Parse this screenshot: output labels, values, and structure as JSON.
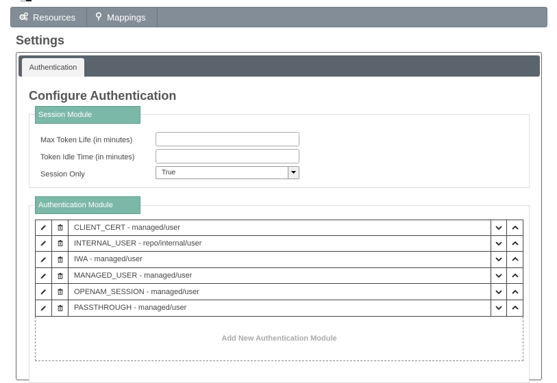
{
  "nav": {
    "items": [
      {
        "label": "Resources",
        "icon": "cogs-icon"
      },
      {
        "label": "Mappings",
        "icon": "map-marker-icon"
      }
    ]
  },
  "page_title": "Settings",
  "tabs": [
    {
      "label": "Authentication",
      "active": true
    }
  ],
  "section_title": "Configure Authentication",
  "session_module": {
    "legend": "Session Module",
    "fields": {
      "max_token_life": {
        "label": "Max Token Life (in minutes)",
        "value": ""
      },
      "token_idle_time": {
        "label": "Token Idle Time (in minutes)",
        "value": ""
      },
      "session_only": {
        "label": "Session Only",
        "value": "True"
      }
    }
  },
  "auth_module": {
    "legend": "Authentication Module",
    "modules": [
      {
        "name": "CLIENT_CERT - managed/user"
      },
      {
        "name": "INTERNAL_USER - repo/internal/user"
      },
      {
        "name": "IWA - managed/user"
      },
      {
        "name": "MANAGED_USER - managed/user"
      },
      {
        "name": "OPENAM_SESSION - managed/user"
      },
      {
        "name": "PASSTHROUGH - managed/user"
      }
    ],
    "add_label": "Add New Authentication Module"
  },
  "colors": {
    "nav_bg": "#838d97",
    "tabbar_bg": "#5b646d",
    "legend_bg": "#7cb8a8"
  }
}
